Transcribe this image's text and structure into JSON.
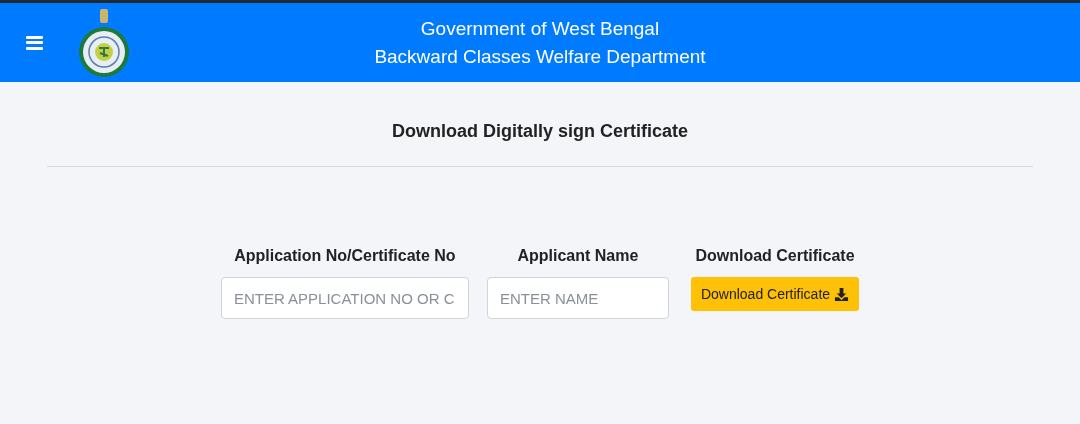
{
  "header": {
    "title_lines": [
      "Government of West Bengal",
      "Backward Classes Welfare Department"
    ]
  },
  "page": {
    "heading": "Download Digitally sign Certificate"
  },
  "form": {
    "fields": [
      {
        "kind": "input",
        "label": "Application No/Certificate No",
        "placeholder": "ENTER APPLICATION NO OR C"
      },
      {
        "kind": "input",
        "label": "Applicant Name",
        "placeholder": "ENTER NAME"
      },
      {
        "kind": "button",
        "label": "Download Certificate",
        "button": "Download Certificate"
      }
    ]
  }
}
